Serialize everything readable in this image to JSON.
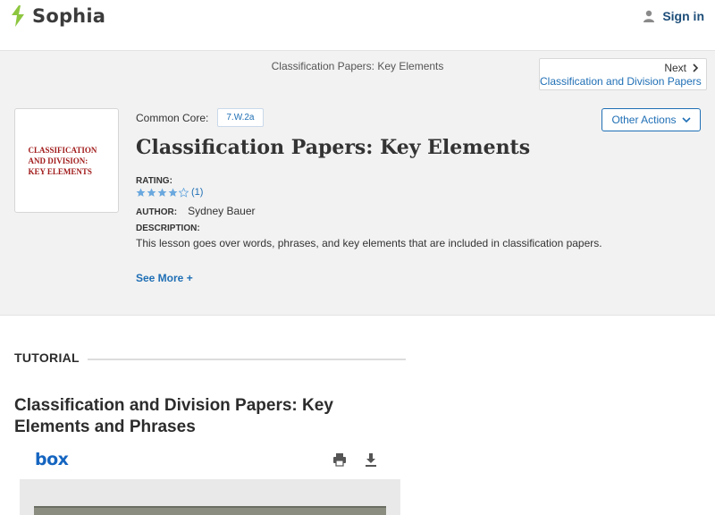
{
  "header": {
    "logo_text": "Sophia",
    "signin_label": "Sign in",
    "brand_color": "#8dc63f"
  },
  "breadcrumb": {
    "current_title": "Classification Papers: Key Elements",
    "next_label": "Next",
    "next_link": "Classification and Division Papers"
  },
  "lesson": {
    "thumbnail_text": "CLASSIFICATION AND DIVISION: KEY ELEMENTS",
    "common_core_label": "Common Core:",
    "common_core_code": "7.W.2a",
    "other_actions_label": "Other Actions",
    "title": "Classification Papers: Key Elements",
    "rating_label": "RATING:",
    "rating_value": 4,
    "rating_max": 5,
    "rating_count": "(1)",
    "author_label": "AUTHOR:",
    "author_name": "Sydney Bauer",
    "description_label": "DESCRIPTION:",
    "description": "This lesson goes over words, phrases, and key elements that are included in classification papers.",
    "see_more_label": "See More +"
  },
  "tutorial": {
    "section_label": "TUTORIAL",
    "title": "Classification and Division Papers: Key Elements and Phrases",
    "viewer_logo": "box",
    "viewer_icons": [
      "print-icon",
      "download-icon"
    ]
  }
}
